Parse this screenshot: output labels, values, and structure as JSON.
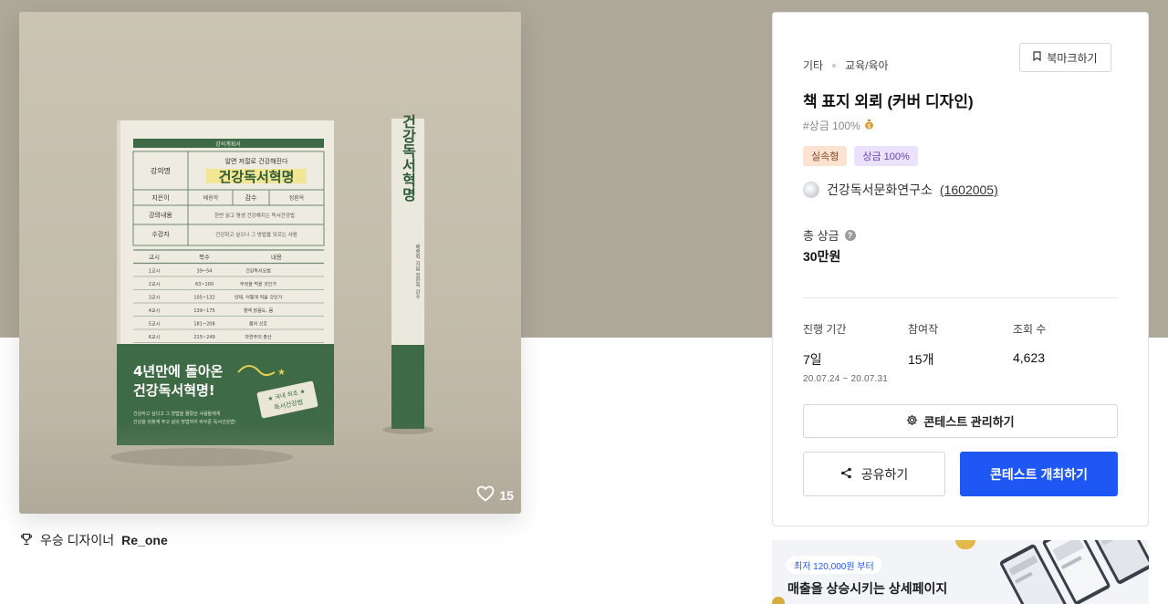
{
  "artwork": {
    "alt": "책 표지 외뢰 커버 디자인 목업",
    "like_count": "15",
    "cover": {
      "header_small": "강의계획서",
      "row_title_label": "강의명",
      "subtitle": "알면 저절로 건강해진다",
      "book_title": "건강독서혁명",
      "row_teacher_label": "지은이",
      "teacher_name": "배용학",
      "row_supervisor_label": "감수",
      "supervisor_name": "정환옥",
      "row_content_label": "강의내용",
      "content_text": "한번 읽고 평생 건강해지는 독서건강법",
      "row_target_label": "수강자",
      "target_text": "건강하고 싶으나 그 방법을 모르는 사람",
      "table_head": [
        "교시",
        "쪽수",
        "내용"
      ],
      "table_rows": [
        [
          "1교시",
          "39~54",
          "건강독서요법"
        ],
        [
          "2교시",
          "63~100",
          "무엇을 먹을 것인가"
        ],
        [
          "3교시",
          "105~132",
          "언제, 어떻게 먹을 것인가"
        ],
        [
          "4교시",
          "139~175",
          "혈액 맑음도, 몸"
        ],
        [
          "5교시",
          "181~208",
          "몸의 신호"
        ],
        [
          "6교시",
          "215~249",
          "자연주의 출산"
        ]
      ],
      "band_headline_1": "4년만에 돌아온",
      "band_headline_2": "건강독서혁명!",
      "band_desc_1": "건강하고 싶다고 그 방법을 몰랐던 사람들에게",
      "band_desc_2": "건강을 되찾게 주고 삶의 방법까지 바꾸준 독서건강법!",
      "stamp_1": "★ 국내 최초 ★",
      "stamp_2": "독서건강법",
      "spine_title": "건강독서혁명",
      "spine_author": "배용학 지음 정환옥 감수"
    }
  },
  "winner": {
    "label": "우승 디자이너",
    "name": "Re_one"
  },
  "info": {
    "breadcrumb": [
      "기타",
      "교육/육아"
    ],
    "bookmark_label": "북마크하기",
    "title": "책 표지 외뢰 (커버 디자인)",
    "prize_tag": "#상금 100%",
    "chips": [
      "실속형",
      "상금 100%"
    ],
    "host_name": "건강독서문화연구소",
    "host_id": "(1602005)",
    "total_prize_label": "총 상금",
    "total_prize_value": "30만원",
    "stats": {
      "period_label": "진행 기간",
      "period_value": "7일",
      "period_range": "20.07.24 ~ 20.07.31",
      "participants_label": "참여작",
      "participants_value": "15개",
      "views_label": "조회 수",
      "views_value": "4,623"
    },
    "manage_label": "콘테스트 관리하기",
    "share_label": "공유하기",
    "host_contest_label": "콘테스트 개최하기"
  },
  "ad": {
    "badge": "최저 120,000원 부터",
    "text": "매출을 상승시키는 상세페이지"
  },
  "colors": {
    "accent_blue": "#1f57f5",
    "band_background": "#aea89a",
    "book_green": "#3e6a45",
    "chip_practical_bg": "#fbe2d1",
    "chip_prize_bg": "#ebe1fb"
  }
}
